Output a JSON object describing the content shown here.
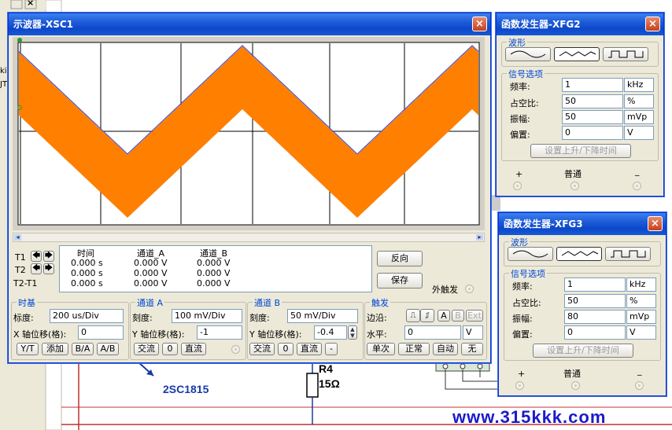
{
  "watermark": "www.315kkk.com",
  "circuit": {
    "transistor_label": "2SC1815",
    "resistor_name": "R4",
    "resistor_value": "15Ω",
    "left_text_1": "ki",
    "left_text_2": "JT"
  },
  "oscilloscope": {
    "title": "示波器-XSC1",
    "close": "×",
    "cursor_headers": [
      "时间",
      "通道_A",
      "通道_B"
    ],
    "cursor_rows": [
      {
        "label": "T1",
        "time": "0.000 s",
        "a": "0.000 V",
        "b": "0.000 V"
      },
      {
        "label": "T2",
        "time": "0.000 s",
        "a": "0.000 V",
        "b": "0.000 V"
      },
      {
        "label": "T2-T1",
        "time": "0.000 s",
        "a": "0.000 V",
        "b": "0.000 V"
      }
    ],
    "reverse_btn": "反向",
    "save_btn": "保存",
    "ext_trigger": "外触发",
    "timebase": {
      "title": "时基",
      "scale_label": "标度:",
      "scale": "200 us/Div",
      "xpos_label": "X 轴位移(格):",
      "xpos": "0",
      "buttons": [
        "Y/T",
        "添加",
        "B/A",
        "A/B"
      ]
    },
    "chA": {
      "title": "通道 A",
      "scale_label": "刻度:",
      "scale": "100 mV/Div",
      "ypos_label": "Y 轴位移(格):",
      "ypos": "-1",
      "buttons": [
        "交流",
        "0",
        "直流"
      ]
    },
    "chB": {
      "title": "通道 B",
      "scale_label": "刻度:",
      "scale": "50 mV/Div",
      "ypos_label": "Y 轴位移(格):",
      "ypos": "-0.4",
      "buttons": [
        "交流",
        "0",
        "直流",
        "-"
      ]
    },
    "trigger": {
      "title": "触发",
      "edge_label": "边沿:",
      "level_label": "水平:",
      "level": "0",
      "level_unit": "V",
      "src_buttons": [
        "A",
        "B",
        "Ext"
      ],
      "mode_buttons": [
        "单次",
        "正常",
        "自动",
        "无"
      ]
    },
    "colors": {
      "trace_fill": "#ff7f00",
      "trace_line": "#5050c0",
      "screen": "#ffffff"
    }
  },
  "fg2": {
    "title": "函数发生器-XFG2",
    "close": "×",
    "wave_title": "波形",
    "signal_title": "信号选项",
    "rows": [
      {
        "label": "频率:",
        "value": "1",
        "unit": "kHz"
      },
      {
        "label": "占空比:",
        "value": "50",
        "unit": "%"
      },
      {
        "label": "振幅:",
        "value": "50",
        "unit": "mVp"
      },
      {
        "label": "偏置:",
        "value": "0",
        "unit": "V"
      }
    ],
    "rise_fall_btn": "设置上升/下降时间",
    "plus": "+",
    "common": "普通",
    "minus": "_"
  },
  "fg3": {
    "title": "函数发生器-XFG3",
    "close": "×",
    "wave_title": "波形",
    "signal_title": "信号选项",
    "rows": [
      {
        "label": "频率:",
        "value": "1",
        "unit": "kHz"
      },
      {
        "label": "占空比:",
        "value": "50",
        "unit": "%"
      },
      {
        "label": "振幅:",
        "value": "80",
        "unit": "mVp"
      },
      {
        "label": "偏置:",
        "value": "0",
        "unit": "V"
      }
    ],
    "rise_fall_btn": "设置上升/下降时间",
    "plus": "+",
    "common": "普通",
    "minus": "_"
  },
  "background_close": "×"
}
